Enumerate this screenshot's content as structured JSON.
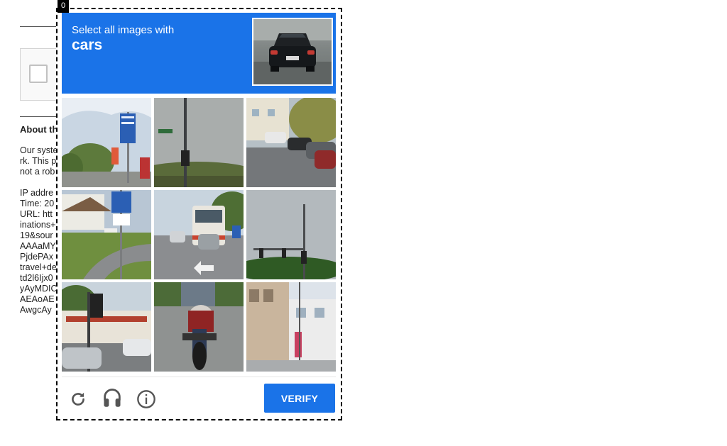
{
  "background": {
    "heading": "About th",
    "paragraph_lines": [
      "Our syste",
      "rk. This p",
      "not a rob"
    ],
    "info_lines": [
      "IP addre",
      "Time: 20",
      "URL: htt",
      "inations+",
      "19&sour",
      "AAAaMY",
      "PjdePAx",
      "travel+de",
      "td2l6Ijx0",
      "yAyMDIC",
      "AEAoAE",
      "AwgcAy"
    ]
  },
  "challenge": {
    "index_badge": "0",
    "instruction_line1": "Select all images with",
    "instruction_target": "cars",
    "tiles": [
      {
        "subject": "road-sign-trees"
      },
      {
        "subject": "traffic-light-sky"
      },
      {
        "subject": "parked-cars-street"
      },
      {
        "subject": "bike-path-signs"
      },
      {
        "subject": "bus-and-cars-road"
      },
      {
        "subject": "traffic-light-trees"
      },
      {
        "subject": "traffic-light-storefront-cars"
      },
      {
        "subject": "motorcycle-rider"
      },
      {
        "subject": "street-corner-building"
      }
    ],
    "controls": {
      "reload_icon": "reload-icon",
      "audio_icon": "headphones-icon",
      "info_icon": "info-icon",
      "verify_label": "VERIFY"
    }
  },
  "colors": {
    "accent": "#1a73e8",
    "header_text": "#ffffff",
    "icon": "#555555"
  }
}
